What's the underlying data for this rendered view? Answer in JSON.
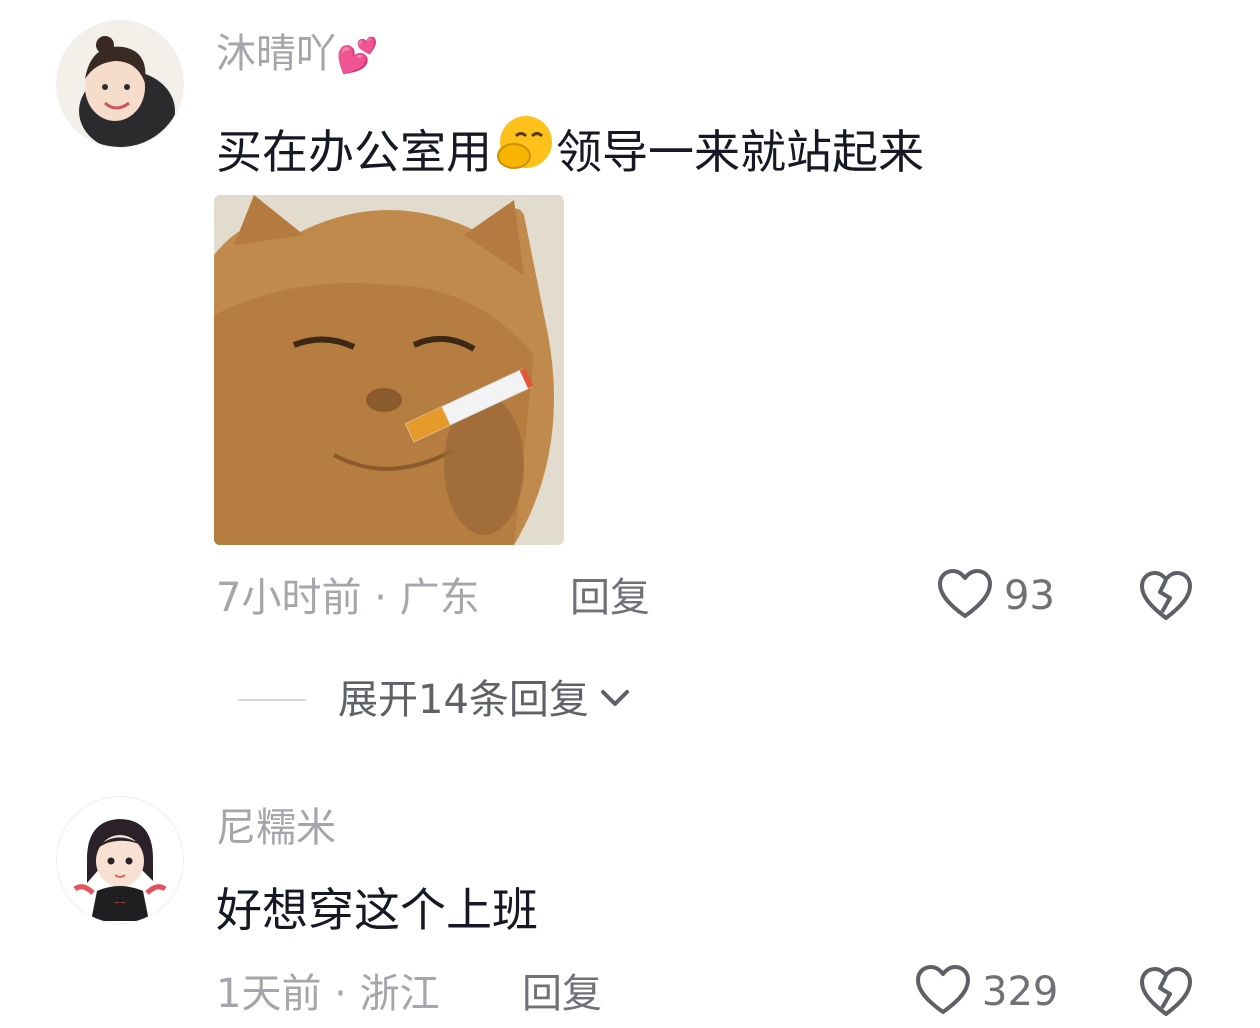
{
  "comments": [
    {
      "username": "沐晴吖",
      "username_emoji": "💕",
      "text_before": "买在办公室用",
      "text_emoji": "🤭",
      "text_after": "领导一来就站起来",
      "time": "7小时前",
      "separator": "·",
      "location": "广东",
      "reply_label": "回复",
      "likes": "93",
      "expand_label": "展开14条回复"
    },
    {
      "username": "尼糯米",
      "text": "好想穿这个上班",
      "time": "1天前",
      "separator": "·",
      "location": "浙江",
      "reply_label": "回复",
      "likes": "329"
    }
  ],
  "icons": {
    "like": "heart-outline-icon",
    "dislike": "broken-heart-icon",
    "expand": "chevron-down-icon"
  },
  "colors": {
    "primary_text": "#161823",
    "secondary_text": "#a4a6ab",
    "action_text": "#6f7177"
  }
}
